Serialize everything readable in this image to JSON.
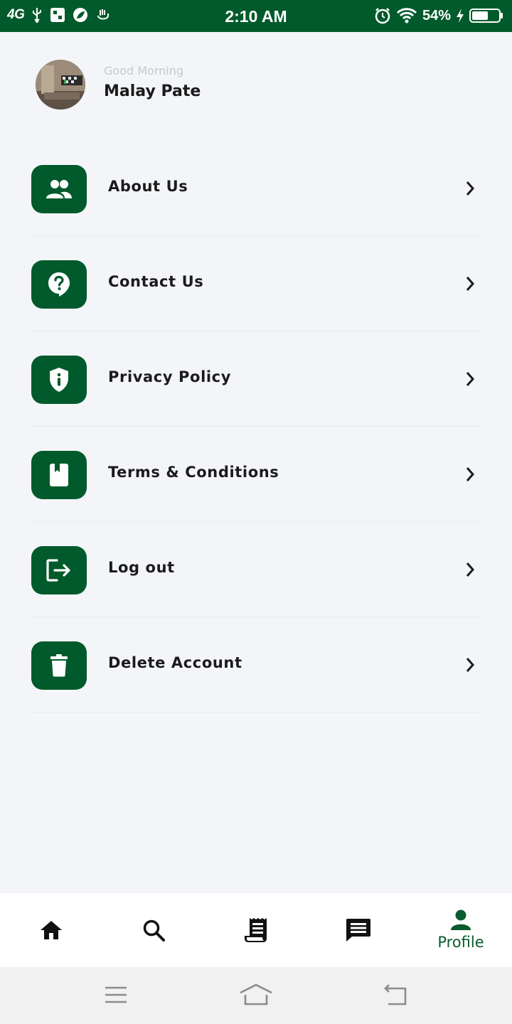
{
  "status_bar": {
    "network": "4G",
    "time": "2:10 AM",
    "battery_percent": "54%"
  },
  "header": {
    "greeting": "Good Morning",
    "user_name": "Malay Pate"
  },
  "menu": {
    "items": [
      {
        "label": "About Us",
        "icon": "people-icon"
      },
      {
        "label": "Contact Us",
        "icon": "help-bubble-icon"
      },
      {
        "label": "Privacy Policy",
        "icon": "shield-info-icon"
      },
      {
        "label": "Terms & Conditions",
        "icon": "book-icon"
      },
      {
        "label": "Log out",
        "icon": "logout-icon"
      },
      {
        "label": "Delete Account",
        "icon": "trash-icon"
      }
    ]
  },
  "bottom_nav": {
    "items": [
      {
        "icon": "home-icon",
        "label": ""
      },
      {
        "icon": "search-icon",
        "label": ""
      },
      {
        "icon": "receipt-icon",
        "label": ""
      },
      {
        "icon": "message-icon",
        "label": ""
      },
      {
        "icon": "profile-icon",
        "label": "Profile",
        "active": true
      }
    ]
  },
  "colors": {
    "brand": "#005a2b",
    "background": "#f3f5f8",
    "text": "#1b1b1b",
    "muted": "#c7c9cc"
  }
}
